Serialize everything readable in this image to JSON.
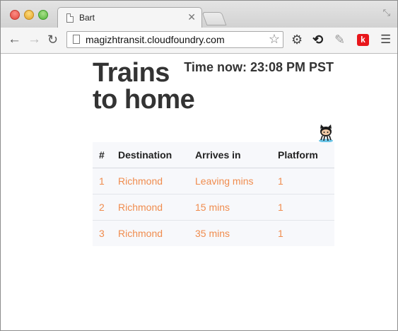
{
  "browser": {
    "tab_title": "Bart",
    "url": "magizhtransit.cloudfoundry.com",
    "extension_k_label": "k"
  },
  "page": {
    "headline_line1": "Trains",
    "headline_line2": "to home",
    "time_now": "Time now: 23:08 PM PST"
  },
  "table": {
    "headers": [
      "#",
      "Destination",
      "Arrives in",
      "Platform"
    ],
    "rows": [
      [
        "1",
        "Richmond",
        "Leaving mins",
        "1"
      ],
      [
        "2",
        "Richmond",
        "15 mins",
        "1"
      ],
      [
        "3",
        "Richmond",
        "35 mins",
        "1"
      ]
    ]
  },
  "colors": {
    "link_orange": "#f08c4e",
    "table_bg": "#f7f8fb",
    "text_dark": "#333333"
  }
}
